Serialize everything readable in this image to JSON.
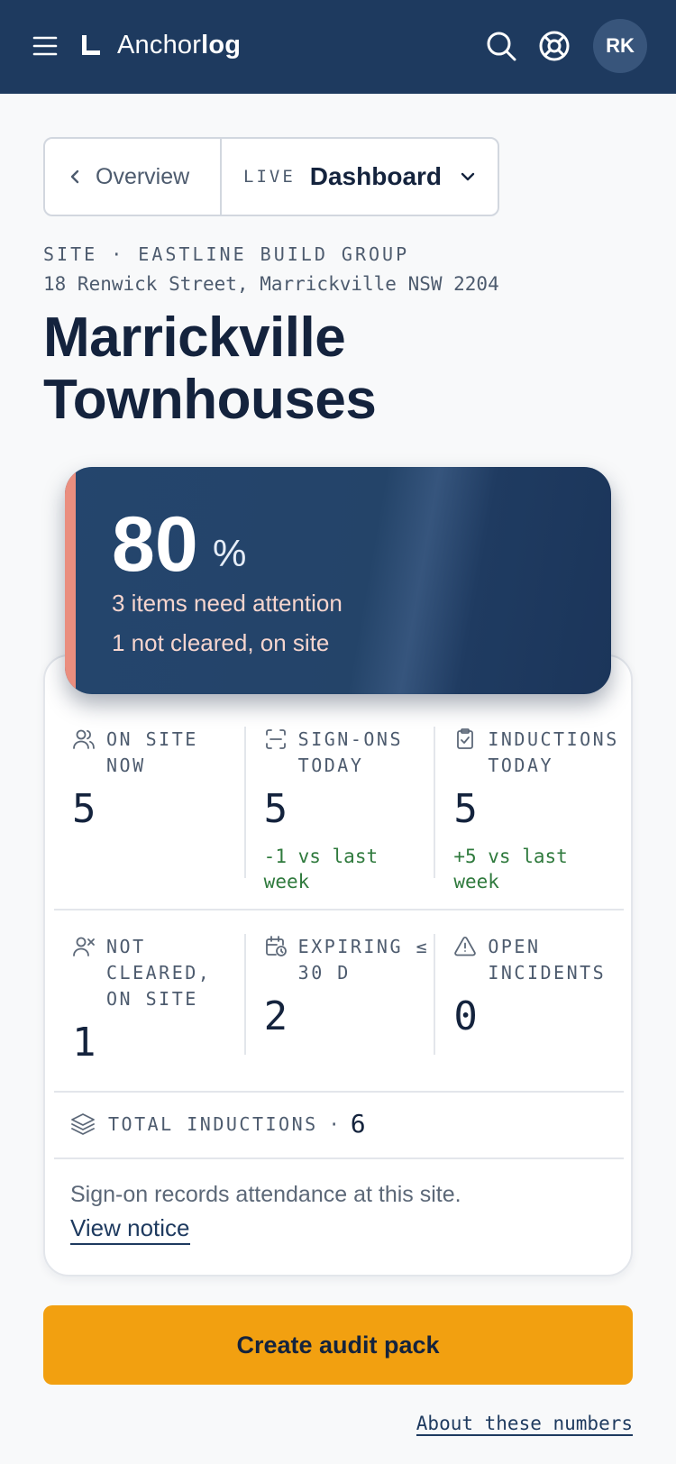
{
  "header": {
    "brand_light": "Anchor",
    "brand_bold": "log",
    "avatar_initials": "RK"
  },
  "nav": {
    "back_label": "Overview",
    "live_label": "LIVE",
    "current_label": "Dashboard"
  },
  "site": {
    "tag": "SITE · EASTLINE BUILD GROUP",
    "address": "18 Renwick Street, Marrickville NSW 2204",
    "title": "Marrickville Townhouses"
  },
  "score": {
    "value": "80",
    "unit": "%",
    "line1": "3 items need attention",
    "line2": "1 not cleared, on site",
    "accent_color": "#ea8e7f"
  },
  "stats": {
    "row1": [
      {
        "icon": "users-icon",
        "label": "ON SITE NOW",
        "value": "5",
        "delta": ""
      },
      {
        "icon": "scan-icon",
        "label": "SIGN-ONS TODAY",
        "value": "5",
        "delta": "-1 vs last week"
      },
      {
        "icon": "clipboard-check-icon",
        "label": "INDUCTIONS TODAY",
        "value": "5",
        "delta": "+5 vs last week"
      }
    ],
    "row2": [
      {
        "icon": "user-x-icon",
        "label": "NOT CLEARED, ON SITE",
        "value": "1"
      },
      {
        "icon": "calendar-clock-icon",
        "label": "EXPIRING ≤ 30 D",
        "value": "2"
      },
      {
        "icon": "alert-triangle-icon",
        "label": "OPEN INCIDENTS",
        "value": "0"
      }
    ],
    "total_label": "TOTAL INDUCTIONS",
    "total_sep": "·",
    "total_value": "6",
    "notice_text": "Sign-on records attendance at this site.",
    "notice_link": "View notice"
  },
  "actions": {
    "cta_label": "Create audit pack",
    "about_link": "About these numbers"
  },
  "colors": {
    "header_bg": "#1e3a5f",
    "cta_bg": "#f2a010",
    "positive_delta": "#2f7a3d"
  }
}
